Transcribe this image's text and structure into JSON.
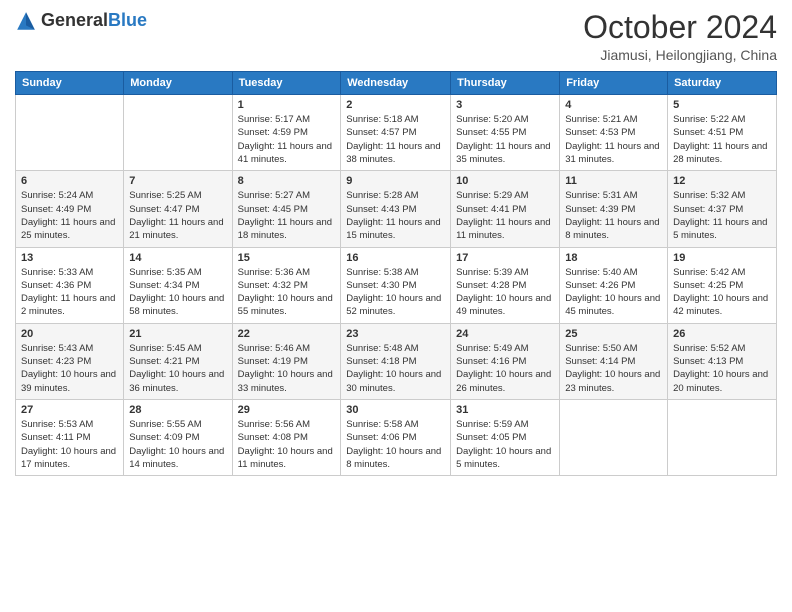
{
  "logo": {
    "text_general": "General",
    "text_blue": "Blue"
  },
  "header": {
    "month_title": "October 2024",
    "location": "Jiamusi, Heilongjiang, China"
  },
  "days_of_week": [
    "Sunday",
    "Monday",
    "Tuesday",
    "Wednesday",
    "Thursday",
    "Friday",
    "Saturday"
  ],
  "weeks": [
    [
      {
        "day": "",
        "info": ""
      },
      {
        "day": "",
        "info": ""
      },
      {
        "day": "1",
        "info": "Sunrise: 5:17 AM\nSunset: 4:59 PM\nDaylight: 11 hours and 41 minutes."
      },
      {
        "day": "2",
        "info": "Sunrise: 5:18 AM\nSunset: 4:57 PM\nDaylight: 11 hours and 38 minutes."
      },
      {
        "day": "3",
        "info": "Sunrise: 5:20 AM\nSunset: 4:55 PM\nDaylight: 11 hours and 35 minutes."
      },
      {
        "day": "4",
        "info": "Sunrise: 5:21 AM\nSunset: 4:53 PM\nDaylight: 11 hours and 31 minutes."
      },
      {
        "day": "5",
        "info": "Sunrise: 5:22 AM\nSunset: 4:51 PM\nDaylight: 11 hours and 28 minutes."
      }
    ],
    [
      {
        "day": "6",
        "info": "Sunrise: 5:24 AM\nSunset: 4:49 PM\nDaylight: 11 hours and 25 minutes."
      },
      {
        "day": "7",
        "info": "Sunrise: 5:25 AM\nSunset: 4:47 PM\nDaylight: 11 hours and 21 minutes."
      },
      {
        "day": "8",
        "info": "Sunrise: 5:27 AM\nSunset: 4:45 PM\nDaylight: 11 hours and 18 minutes."
      },
      {
        "day": "9",
        "info": "Sunrise: 5:28 AM\nSunset: 4:43 PM\nDaylight: 11 hours and 15 minutes."
      },
      {
        "day": "10",
        "info": "Sunrise: 5:29 AM\nSunset: 4:41 PM\nDaylight: 11 hours and 11 minutes."
      },
      {
        "day": "11",
        "info": "Sunrise: 5:31 AM\nSunset: 4:39 PM\nDaylight: 11 hours and 8 minutes."
      },
      {
        "day": "12",
        "info": "Sunrise: 5:32 AM\nSunset: 4:37 PM\nDaylight: 11 hours and 5 minutes."
      }
    ],
    [
      {
        "day": "13",
        "info": "Sunrise: 5:33 AM\nSunset: 4:36 PM\nDaylight: 11 hours and 2 minutes."
      },
      {
        "day": "14",
        "info": "Sunrise: 5:35 AM\nSunset: 4:34 PM\nDaylight: 10 hours and 58 minutes."
      },
      {
        "day": "15",
        "info": "Sunrise: 5:36 AM\nSunset: 4:32 PM\nDaylight: 10 hours and 55 minutes."
      },
      {
        "day": "16",
        "info": "Sunrise: 5:38 AM\nSunset: 4:30 PM\nDaylight: 10 hours and 52 minutes."
      },
      {
        "day": "17",
        "info": "Sunrise: 5:39 AM\nSunset: 4:28 PM\nDaylight: 10 hours and 49 minutes."
      },
      {
        "day": "18",
        "info": "Sunrise: 5:40 AM\nSunset: 4:26 PM\nDaylight: 10 hours and 45 minutes."
      },
      {
        "day": "19",
        "info": "Sunrise: 5:42 AM\nSunset: 4:25 PM\nDaylight: 10 hours and 42 minutes."
      }
    ],
    [
      {
        "day": "20",
        "info": "Sunrise: 5:43 AM\nSunset: 4:23 PM\nDaylight: 10 hours and 39 minutes."
      },
      {
        "day": "21",
        "info": "Sunrise: 5:45 AM\nSunset: 4:21 PM\nDaylight: 10 hours and 36 minutes."
      },
      {
        "day": "22",
        "info": "Sunrise: 5:46 AM\nSunset: 4:19 PM\nDaylight: 10 hours and 33 minutes."
      },
      {
        "day": "23",
        "info": "Sunrise: 5:48 AM\nSunset: 4:18 PM\nDaylight: 10 hours and 30 minutes."
      },
      {
        "day": "24",
        "info": "Sunrise: 5:49 AM\nSunset: 4:16 PM\nDaylight: 10 hours and 26 minutes."
      },
      {
        "day": "25",
        "info": "Sunrise: 5:50 AM\nSunset: 4:14 PM\nDaylight: 10 hours and 23 minutes."
      },
      {
        "day": "26",
        "info": "Sunrise: 5:52 AM\nSunset: 4:13 PM\nDaylight: 10 hours and 20 minutes."
      }
    ],
    [
      {
        "day": "27",
        "info": "Sunrise: 5:53 AM\nSunset: 4:11 PM\nDaylight: 10 hours and 17 minutes."
      },
      {
        "day": "28",
        "info": "Sunrise: 5:55 AM\nSunset: 4:09 PM\nDaylight: 10 hours and 14 minutes."
      },
      {
        "day": "29",
        "info": "Sunrise: 5:56 AM\nSunset: 4:08 PM\nDaylight: 10 hours and 11 minutes."
      },
      {
        "day": "30",
        "info": "Sunrise: 5:58 AM\nSunset: 4:06 PM\nDaylight: 10 hours and 8 minutes."
      },
      {
        "day": "31",
        "info": "Sunrise: 5:59 AM\nSunset: 4:05 PM\nDaylight: 10 hours and 5 minutes."
      },
      {
        "day": "",
        "info": ""
      },
      {
        "day": "",
        "info": ""
      }
    ]
  ]
}
